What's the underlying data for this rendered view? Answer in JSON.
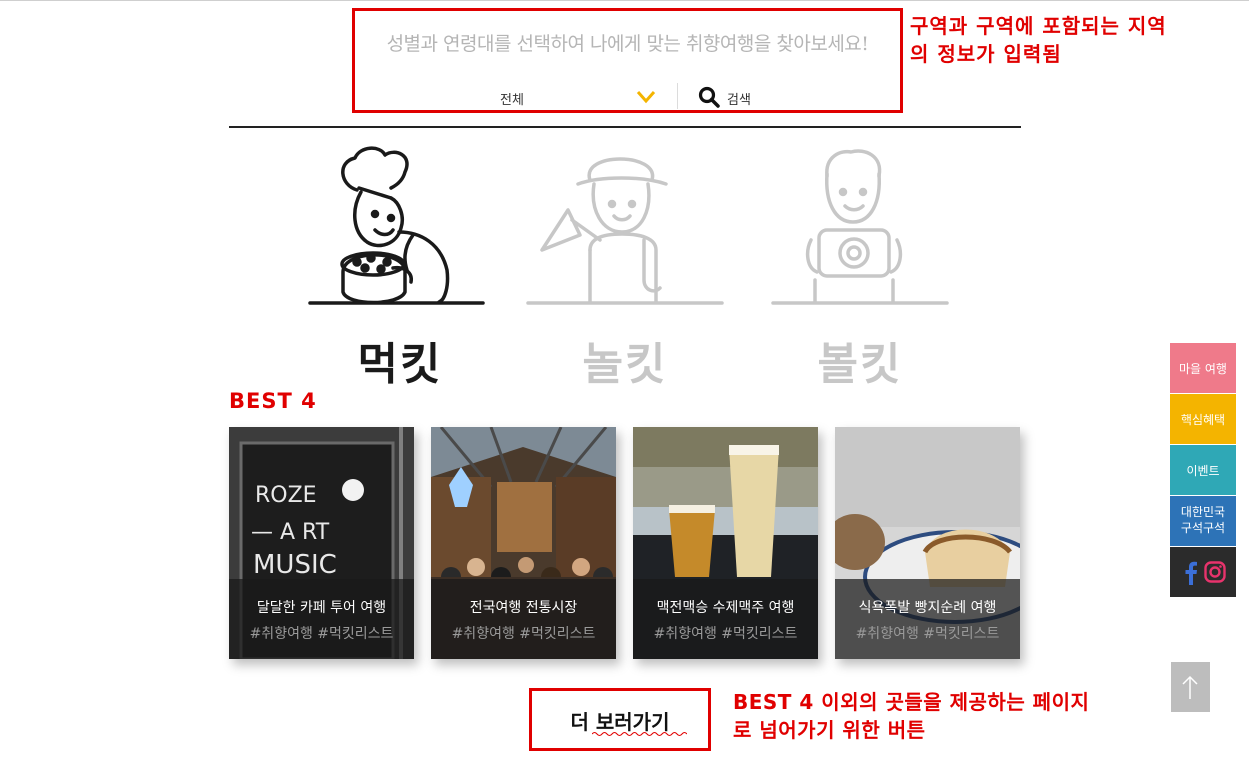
{
  "search": {
    "hint": "성별과 연령대를 선택하여 나에게 맞는 취향여행을 찾아보세요!",
    "selected_category": "전체",
    "button_label": "검색"
  },
  "annotations": {
    "top_line1": "구역과 구역에 포함되는 지역",
    "top_line2": "의 정보가 입력됨",
    "bottom_line1": "BEST 4 이외의 곳들을 제공하는 페이지",
    "bottom_line2": "로 넘어가기 위한 버튼"
  },
  "categories": [
    {
      "label": "먹킷",
      "icon": "chef-icon",
      "active": true
    },
    {
      "label": "놀킷",
      "icon": "traveler-icon",
      "active": false
    },
    {
      "label": "볼킷",
      "icon": "photographer-icon",
      "active": false
    }
  ],
  "best": {
    "heading": "BEST 4",
    "cards": [
      {
        "title": "달달한 카페 투어 여행",
        "tags": "#취향여행 #먹킷리스트",
        "sign_line1": "ROZE",
        "sign_line2": "— A RT",
        "sign_line3": "MUSIC"
      },
      {
        "title": "전국여행 전통시장",
        "tags": "#취향여행 #먹킷리스트"
      },
      {
        "title": "맥전맥승 수제맥주 여행",
        "tags": "#취향여행 #먹킷리스트"
      },
      {
        "title": "식욕폭발 빵지순례 여행",
        "tags": "#취향여행 #먹킷리스트"
      }
    ]
  },
  "more_button": {
    "label": "더 보러가기"
  },
  "side_menu": {
    "items": [
      "마을 여행",
      "핵심혜택",
      "이벤트"
    ],
    "map_line1": "대한민국",
    "map_line2": "구석구석",
    "colors": [
      "#ef7a8a",
      "#f4b400",
      "#2fa8b6",
      "#2d73b7",
      "#2b2b2b"
    ]
  },
  "accent_color": "#e00000"
}
